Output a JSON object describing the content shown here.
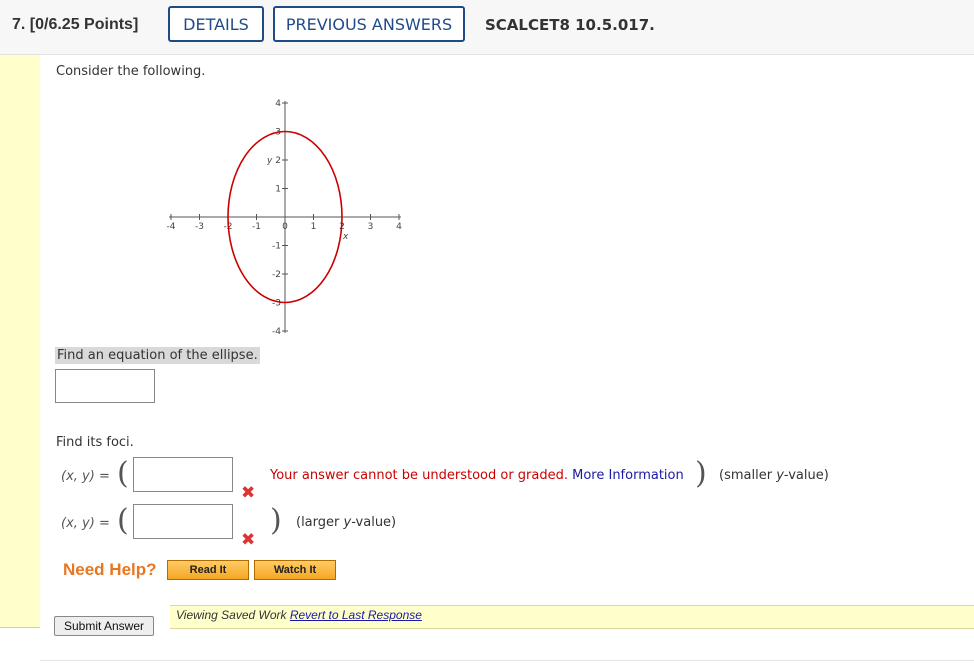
{
  "header": {
    "question": "7. [0/6.25 Points]",
    "details_label": "DETAILS",
    "prev_answers_label": "PREVIOUS ANSWERS",
    "code": "SCALCET8 10.5.017."
  },
  "prompt": "Consider the following.",
  "graph": {
    "y_label": "y",
    "x_label": "x",
    "x_ticks": [
      "-4",
      "-3",
      "-2",
      "-1",
      "0",
      "1",
      "2",
      "3",
      "4"
    ],
    "y_ticks": [
      "4",
      "3",
      "2",
      "1",
      "-1",
      "-2",
      "-3",
      "-4"
    ],
    "ellipse_color": "#cc0000"
  },
  "find_equation": "Find an equation of the ellipse.",
  "find_foci": "Find its foci.",
  "xy_label": "(x, y)",
  "equals": "=",
  "foci_rows": [
    {
      "hint_pre": "(smaller ",
      "hint_var": "y",
      "hint_post": "-value)"
    },
    {
      "hint_pre": "(larger ",
      "hint_var": "y",
      "hint_post": "-value)"
    }
  ],
  "error": {
    "message": "Your answer cannot be understood or graded. ",
    "more_info": "More Information"
  },
  "help": {
    "label": "Need Help?",
    "read_it": "Read It",
    "watch_it": "Watch It"
  },
  "saved": {
    "text": "Viewing Saved Work ",
    "revert": "Revert to Last Response"
  },
  "submit_label": "Submit Answer"
}
